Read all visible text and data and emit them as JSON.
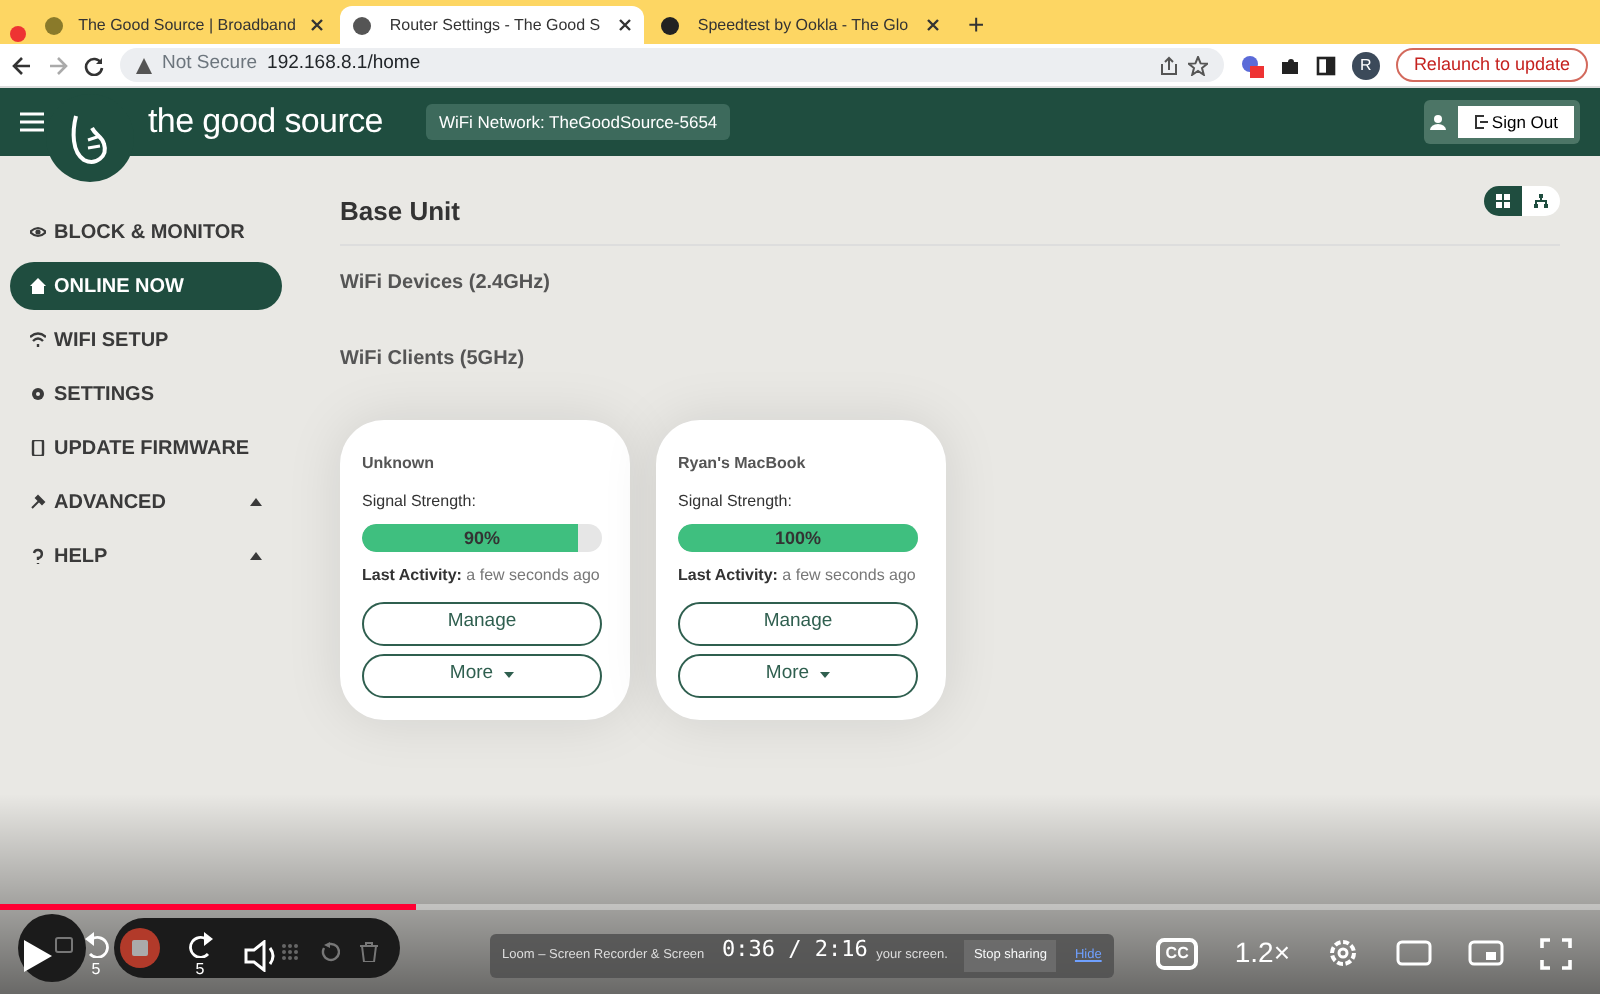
{
  "browser": {
    "tabs": [
      {
        "title": "The Good Source | Broadband",
        "selected": false
      },
      {
        "title": "Router Settings - The Good S",
        "selected": true
      },
      {
        "title": "Speedtest by Ookla - The Glo",
        "selected": false
      }
    ],
    "new_tab": "+",
    "security": "Not Secure",
    "url": "192.168.8.1/home",
    "profile": "R",
    "relaunch": "Relaunch to update"
  },
  "header": {
    "brand": "the good source",
    "network": "WiFi Network: TheGoodSource-5654",
    "sign_out": "Sign Out"
  },
  "sidebar": {
    "items": [
      {
        "label": "BLOCK & MONITOR",
        "selected": false,
        "submenu": false
      },
      {
        "label": "ONLINE NOW",
        "selected": true,
        "submenu": false
      },
      {
        "label": "WIFI SETUP",
        "selected": false,
        "submenu": false
      },
      {
        "label": "SETTINGS",
        "selected": false,
        "submenu": false
      },
      {
        "label": "UPDATE FIRMWARE",
        "selected": false,
        "submenu": false
      },
      {
        "label": "ADVANCED",
        "selected": false,
        "submenu": true
      },
      {
        "label": "HELP",
        "selected": false,
        "submenu": true
      }
    ]
  },
  "main": {
    "title": "Base Unit",
    "view_toggle": [
      {
        "selected": true
      },
      {
        "selected": false
      }
    ],
    "sections": [
      "WiFi Devices (2.4GHz)",
      "WiFi Clients (5GHz)"
    ],
    "devices": [
      {
        "name": "Unknown",
        "signal_label": "Signal Strength:",
        "level": 0.9,
        "reading": "90%",
        "activity_label": "Last Activity:",
        "activity": "a few seconds ago",
        "manage": "Manage",
        "more": "More"
      },
      {
        "name": "Ryan's MacBook",
        "signal_label": "Signal Strength:",
        "level": 1,
        "reading": "100%",
        "activity_label": "Last Activity:",
        "activity": "a few seconds ago",
        "manage": "Manage",
        "more": "More"
      }
    ]
  },
  "loom": {
    "banner": "Loom – Screen Recorder & Screen",
    "banner_end": "your screen.",
    "stop_sharing": "Stop sharing",
    "hide": "Hide"
  },
  "player": {
    "level": 0.26,
    "skip_back": "5",
    "skip_forward": "5",
    "time": "0:36 / 2:16",
    "cc": "CC",
    "speed": "1.2×"
  }
}
